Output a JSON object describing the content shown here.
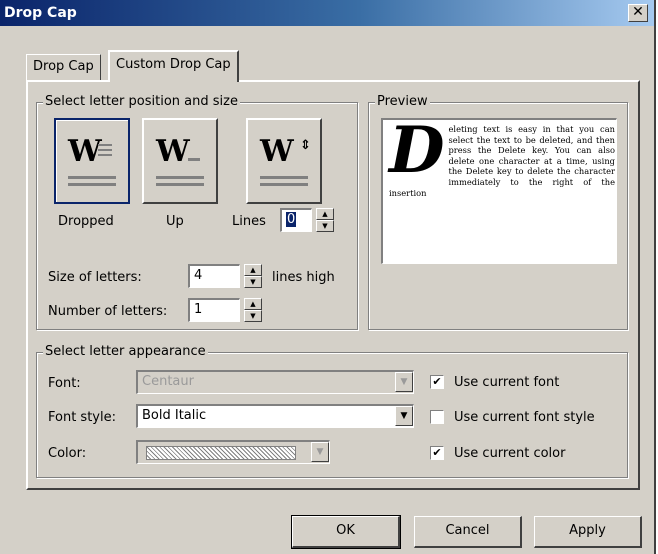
{
  "window": {
    "title": "Drop Cap",
    "close_symbol": "✕"
  },
  "tabs": [
    {
      "label": "Drop Cap",
      "active": false
    },
    {
      "label": "Custom Drop Cap",
      "active": true
    }
  ],
  "position_group": {
    "legend": "Select letter position and size",
    "options": [
      {
        "label": "Dropped",
        "letter": "W",
        "selected": true
      },
      {
        "label": "Up",
        "letter": "W",
        "selected": false
      },
      {
        "label": "Lines",
        "letter": "W",
        "selected": false
      }
    ],
    "lines_value": "0",
    "size_label": "Size of letters:",
    "size_value": "4",
    "size_unit": "lines high",
    "number_label": "Number of letters:",
    "number_value": "1"
  },
  "preview": {
    "legend": "Preview",
    "dropcap_letter": "D",
    "text": "eleting text is easy in that you can select the text to be deleted, and then press the Delete key. You can also delete one character at a time, using the Delete key to delete the character immediately to the right of the insertion"
  },
  "appearance_group": {
    "legend": "Select letter appearance",
    "font_label": "Font:",
    "font_value": "Centaur",
    "font_style_label": "Font style:",
    "font_style_value": "Bold Italic",
    "color_label": "Color:",
    "use_current_font": {
      "label": "Use current font",
      "checked": true
    },
    "use_current_font_style": {
      "label": "Use current font style",
      "checked": false
    },
    "use_current_color": {
      "label": "Use current color",
      "checked": true
    }
  },
  "buttons": {
    "ok": "OK",
    "cancel": "Cancel",
    "apply": "Apply"
  }
}
